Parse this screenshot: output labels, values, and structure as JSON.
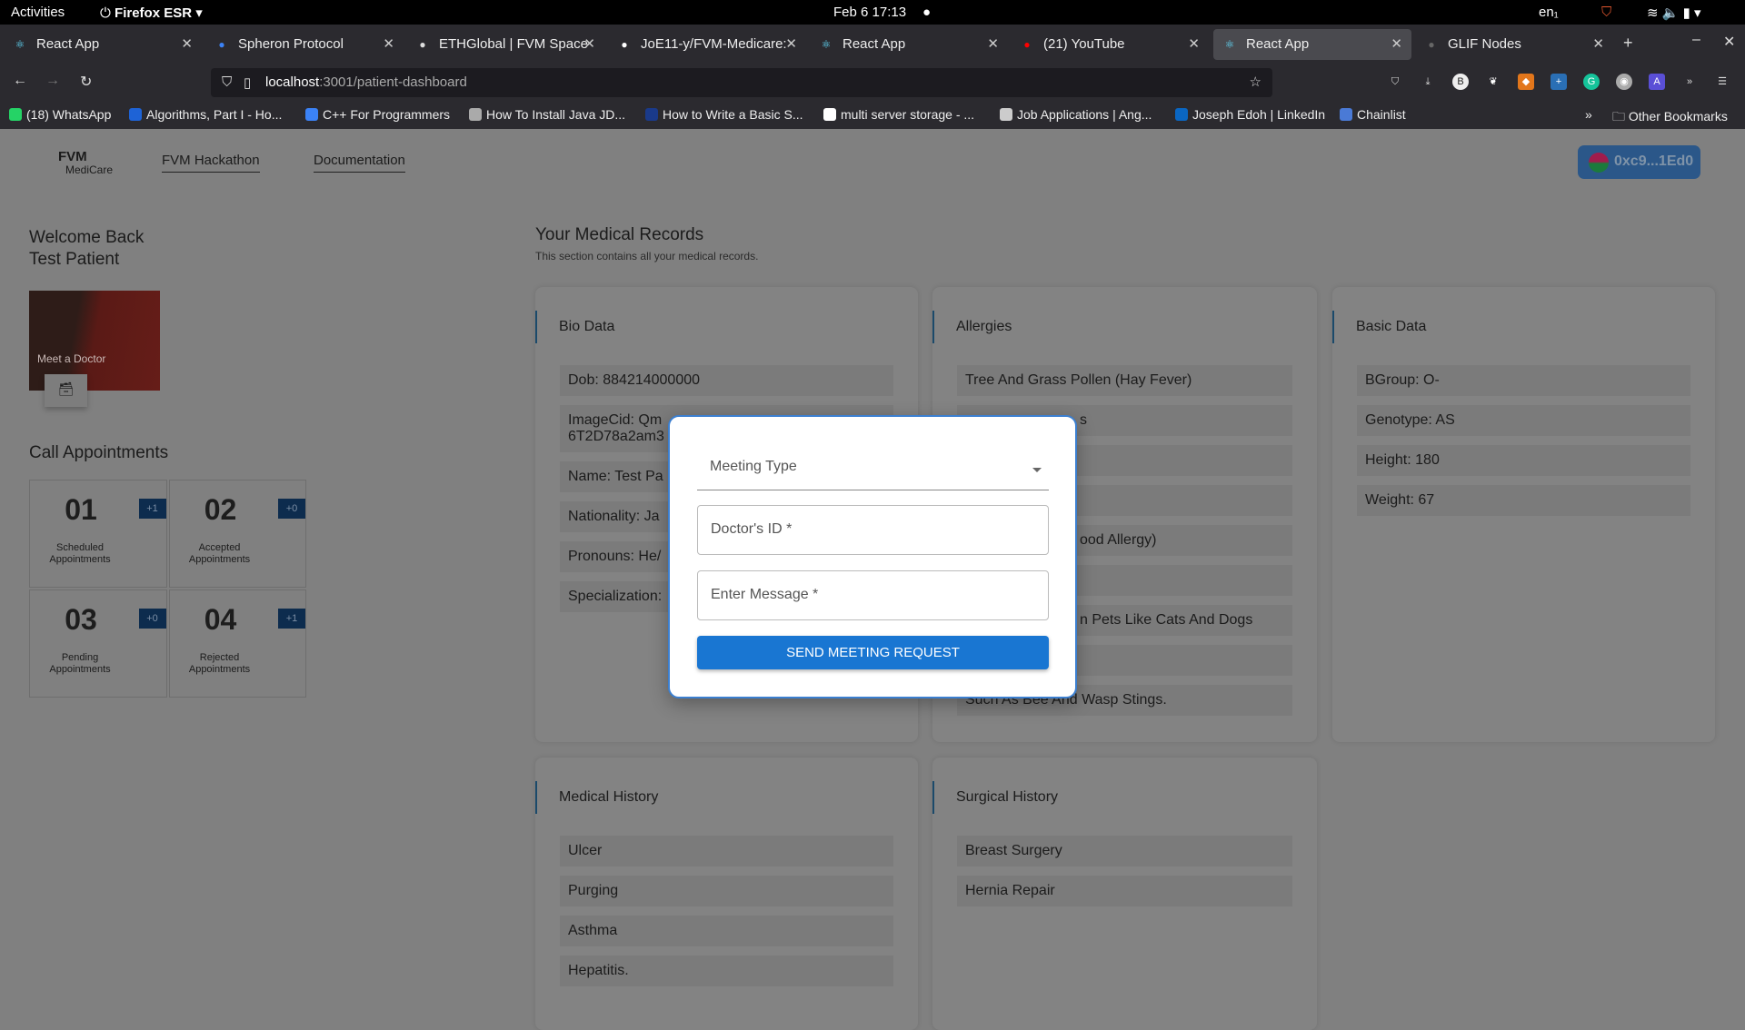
{
  "system": {
    "activities": "Activities",
    "browser": "Firefox ESR",
    "clock": "Feb 6  17:13",
    "lang": "en₁"
  },
  "tabs": [
    {
      "label": "React App",
      "icon": "react-icon",
      "active": false
    },
    {
      "label": "Spheron Protocol",
      "icon": "spheron-icon",
      "active": false
    },
    {
      "label": "ETHGlobal | FVM Space",
      "icon": "ethglobal-icon",
      "active": false
    },
    {
      "label": "JoE11-y/FVM-Medicare:",
      "icon": "github-icon",
      "active": false
    },
    {
      "label": "React App",
      "icon": "react-icon",
      "active": false
    },
    {
      "label": "(21) YouTube",
      "icon": "youtube-icon",
      "active": false
    },
    {
      "label": "React App",
      "icon": "react-icon",
      "active": true
    },
    {
      "label": "GLIF Nodes",
      "icon": "glif-icon",
      "active": false
    }
  ],
  "url": {
    "host": "localhost",
    "rest": ":3001/patient-dashboard"
  },
  "bookmarks": [
    "(18) WhatsApp",
    "Algorithms, Part I - Ho...",
    "C++ For Programmers",
    "How To Install Java JD...",
    "How to Write a Basic S...",
    "multi server storage - ...",
    "Job Applications | Ang...",
    "Joseph Edoh | LinkedIn",
    "Chainlist"
  ],
  "other_bookmarks": "Other Bookmarks",
  "header": {
    "logo_top": "FVM",
    "logo_bottom": "MediCare",
    "nav": [
      "FVM Hackathon",
      "Documentation"
    ],
    "wallet": "0xc9...1Ed0"
  },
  "sidebar": {
    "welcome": "Welcome Back",
    "patient": "Test Patient",
    "doctor_card": "Meet a Doctor",
    "call_title": "Call Appointments",
    "appointments": [
      {
        "num": "01",
        "badge": "+1",
        "label": "Scheduled Appointments"
      },
      {
        "num": "02",
        "badge": "+0",
        "label": "Accepted Appointments"
      },
      {
        "num": "03",
        "badge": "+0",
        "label": "Pending Appointments"
      },
      {
        "num": "04",
        "badge": "+1",
        "label": "Rejected Appointments"
      }
    ]
  },
  "records": {
    "title": "Your Medical Records",
    "subtitle": "This section contains all your medical records.",
    "bio": {
      "title": "Bio Data",
      "items": [
        "Dob: 884214000000",
        "ImageCid: Qm\n6T2D78a2am3",
        "Name: Test Pa",
        "Nationality: Ja",
        "Pronouns: He/",
        "Specialization:"
      ]
    },
    "allergies": {
      "title": "Allergies",
      "items": [
        "Tree And Grass Pollen (Hay Fever)",
        "s",
        "",
        "",
        "ood Allergy)",
        "",
        "n Pets Like Cats And Dogs",
        "",
        "Such As Bee And Wasp Stings."
      ]
    },
    "basic": {
      "title": "Basic Data",
      "items": [
        "BGroup: O-",
        "Genotype: AS",
        "Height: 180",
        "Weight: 67"
      ]
    },
    "medical": {
      "title": "Medical History",
      "items": [
        "Ulcer",
        "Purging",
        "Asthma",
        "Hepatitis."
      ]
    },
    "surgical": {
      "title": "Surgical History",
      "items": [
        "Breast Surgery",
        "Hernia Repair"
      ]
    }
  },
  "modal": {
    "meeting_type": "Meeting Type",
    "doctor_id": "Doctor's ID *",
    "message": "Enter Message *",
    "send": "SEND MEETING REQUEST"
  },
  "colors": {
    "accent": "#1976d2",
    "badge": "#0d2c4e",
    "wallet": "#2b5789"
  }
}
